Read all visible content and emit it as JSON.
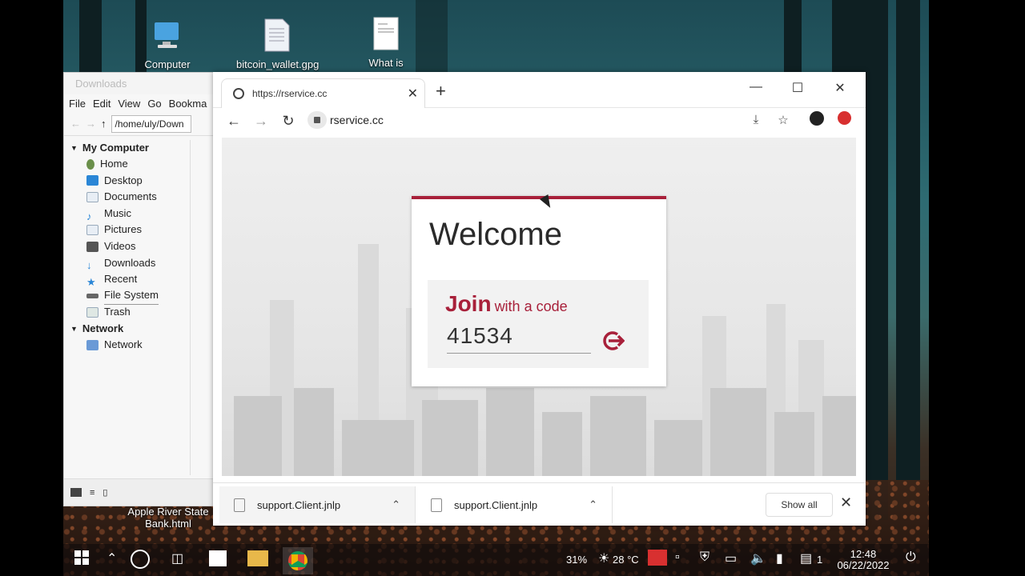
{
  "desktop": {
    "icons": [
      {
        "label": "Computer"
      },
      {
        "label": "bitcoin_wallet.gpg"
      },
      {
        "label": "What is"
      },
      {
        "label": "Apple River State Bank.html"
      }
    ]
  },
  "file_manager": {
    "title": "Downloads",
    "menu": [
      "File",
      "Edit",
      "View",
      "Go",
      "Bookma"
    ],
    "path": "/home/uly/Down",
    "sections": {
      "my_computer": "My Computer",
      "network": "Network"
    },
    "places": [
      "Home",
      "Desktop",
      "Documents",
      "Music",
      "Pictures",
      "Videos",
      "Downloads",
      "Recent",
      "File System",
      "Trash"
    ],
    "network_items": [
      "Network"
    ]
  },
  "browser": {
    "tab_title": "https://rservice.cc",
    "new_tab": "+",
    "url": "rservice.cc",
    "page": {
      "welcome": "Welcome",
      "join": "Join",
      "join_suffix": "with a code",
      "code": "41534"
    },
    "downloads": [
      {
        "name": "support.Client.jnlp"
      },
      {
        "name": "support.Client.jnlp"
      }
    ],
    "show_all": "Show all"
  },
  "taskbar": {
    "battery": "31%",
    "temperature": "28 °C",
    "notifications": "1",
    "time": "12:48",
    "date": "06/22/2022"
  },
  "colors": {
    "brand": "#a8203a"
  }
}
